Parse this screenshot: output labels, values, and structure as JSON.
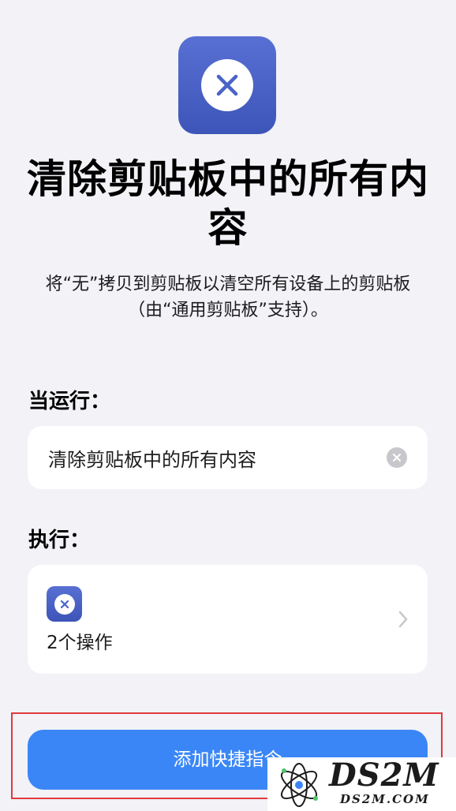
{
  "shortcut": {
    "title": "清除剪贴板中的所有内容",
    "description": "将“无”拷贝到剪贴板以清空所有设备上的剪贴板（由“通用剪贴板”支持）。",
    "icon": "close-icon",
    "icon_color": "#4a63c8"
  },
  "when_run": {
    "label": "当运行：",
    "input_value": "清除剪贴板中的所有内容",
    "clear_icon": "clear-circle-icon"
  },
  "perform": {
    "label": "执行：",
    "action_count": "2个操作",
    "chevron_icon": "chevron-right-icon"
  },
  "primary_button": {
    "label": "添加快捷指令",
    "color": "#3a86f6"
  },
  "highlight": {
    "color": "#e0393e"
  },
  "watermark": {
    "brand": "DS2M",
    "site": "DS2M.COM"
  }
}
